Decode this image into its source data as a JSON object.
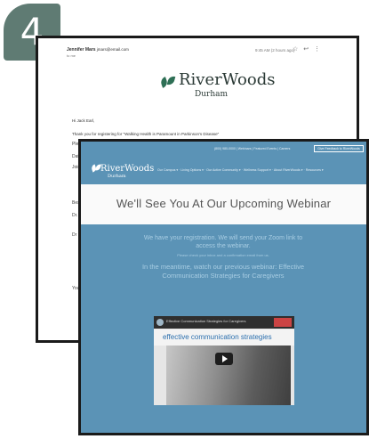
{
  "step": {
    "number": "4"
  },
  "email": {
    "sender": "Jennifer Mars",
    "sender_email": "jmars@email.com",
    "to": "to me",
    "time": "9:45 AM (2 hours ago)",
    "icons": [
      "star-icon",
      "reply-icon",
      "more-icon"
    ],
    "logo": {
      "word": "RiverWoods",
      "sub": "Durham"
    },
    "greeting": "Hi Jack Earl,",
    "thanks_line": "Thank you for registering for \"Walking Health is Paramount in Parkinson's Disease\"",
    "fragments": [
      "Plea",
      "Date",
      "Join",
      "Best",
      "Dr. J",
      "Dr R.",
      "You"
    ]
  },
  "website": {
    "utility_links": [
      "(800) 980-0000",
      "Webinars",
      "Featured Events",
      "Careers"
    ],
    "utility_button": "Give Feedback to RiverWoods",
    "logo": {
      "word": "RiverWoods",
      "sub": "Durham"
    },
    "nav_items": [
      "Our Campus",
      "Living Options",
      "Our Active Community",
      "Wellness Support",
      "About RiverWoods",
      "Resources"
    ],
    "page_title": "We'll See You At Our Upcoming Webinar",
    "body": {
      "line1": "We have your registration. We will send your Zoom link to",
      "line2": "access the webinar.",
      "line3": "Please check your inbox and a confirmation email from us.",
      "line4": "In the meantime, watch our previous webinar: Effective",
      "line5": "Communication Strategies for Caregivers"
    },
    "video": {
      "title": "Effective Communication Strategies for Caregivers",
      "heading": "effective communication strategies"
    }
  }
}
